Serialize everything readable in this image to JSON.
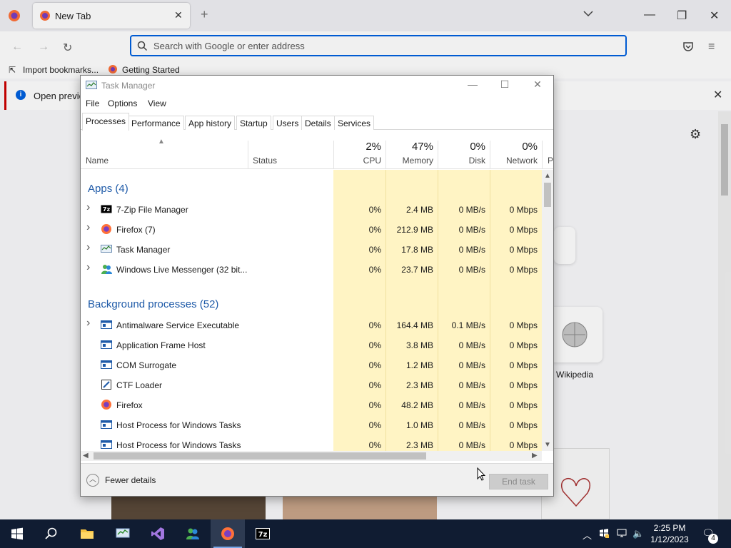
{
  "firefox": {
    "tab_title": "New Tab",
    "url_placeholder": "Search with Google or enter address",
    "bookmarks": [
      "Import bookmarks...",
      "Getting Started"
    ],
    "notice_text": "Open previo",
    "tile_label": "Wikipedia"
  },
  "task_manager": {
    "title": "Task Manager",
    "menu": [
      "File",
      "Options",
      "View"
    ],
    "tabs": [
      "Processes",
      "Performance",
      "App history",
      "Startup",
      "Users",
      "Details",
      "Services"
    ],
    "active_tab": "Processes",
    "columns": {
      "name": "Name",
      "status": "Status",
      "cpu": {
        "pct": "2%",
        "label": "CPU"
      },
      "memory": {
        "pct": "47%",
        "label": "Memory"
      },
      "disk": {
        "pct": "0%",
        "label": "Disk"
      },
      "network": {
        "pct": "0%",
        "label": "Network"
      },
      "power": "P"
    },
    "groups": {
      "apps": "Apps (4)",
      "background": "Background processes (52)"
    },
    "apps": [
      {
        "name": "7-Zip File Manager",
        "cpu": "0%",
        "memory": "2.4 MB",
        "disk": "0 MB/s",
        "network": "0 Mbps",
        "expandable": true
      },
      {
        "name": "Firefox (7)",
        "cpu": "0%",
        "memory": "212.9 MB",
        "disk": "0 MB/s",
        "network": "0 Mbps",
        "expandable": true
      },
      {
        "name": "Task Manager",
        "cpu": "0%",
        "memory": "17.8 MB",
        "disk": "0 MB/s",
        "network": "0 Mbps",
        "expandable": true
      },
      {
        "name": "Windows Live Messenger (32 bit...",
        "cpu": "0%",
        "memory": "23.7 MB",
        "disk": "0 MB/s",
        "network": "0 Mbps",
        "expandable": true
      }
    ],
    "background": [
      {
        "name": "Antimalware Service Executable",
        "cpu": "0%",
        "memory": "164.4 MB",
        "disk": "0.1 MB/s",
        "network": "0 Mbps",
        "expandable": true
      },
      {
        "name": "Application Frame Host",
        "cpu": "0%",
        "memory": "3.8 MB",
        "disk": "0 MB/s",
        "network": "0 Mbps",
        "expandable": false
      },
      {
        "name": "COM Surrogate",
        "cpu": "0%",
        "memory": "1.2 MB",
        "disk": "0 MB/s",
        "network": "0 Mbps",
        "expandable": false
      },
      {
        "name": "CTF Loader",
        "cpu": "0%",
        "memory": "2.3 MB",
        "disk": "0 MB/s",
        "network": "0 Mbps",
        "expandable": false
      },
      {
        "name": "Firefox",
        "cpu": "0%",
        "memory": "48.2 MB",
        "disk": "0 MB/s",
        "network": "0 Mbps",
        "expandable": false
      },
      {
        "name": "Host Process for Windows Tasks",
        "cpu": "0%",
        "memory": "1.0 MB",
        "disk": "0 MB/s",
        "network": "0 Mbps",
        "expandable": false
      },
      {
        "name": "Host Process for Windows Tasks",
        "cpu": "0%",
        "memory": "2.3 MB",
        "disk": "0 MB/s",
        "network": "0 Mbps",
        "expandable": false
      }
    ],
    "fewer_details": "Fewer details",
    "end_task": "End task",
    "colors": {
      "heat": "#fff4c4",
      "group": "#1e5aa8"
    }
  },
  "taskbar": {
    "time": "2:25 PM",
    "date": "1/12/2023",
    "notification_count": "4"
  }
}
